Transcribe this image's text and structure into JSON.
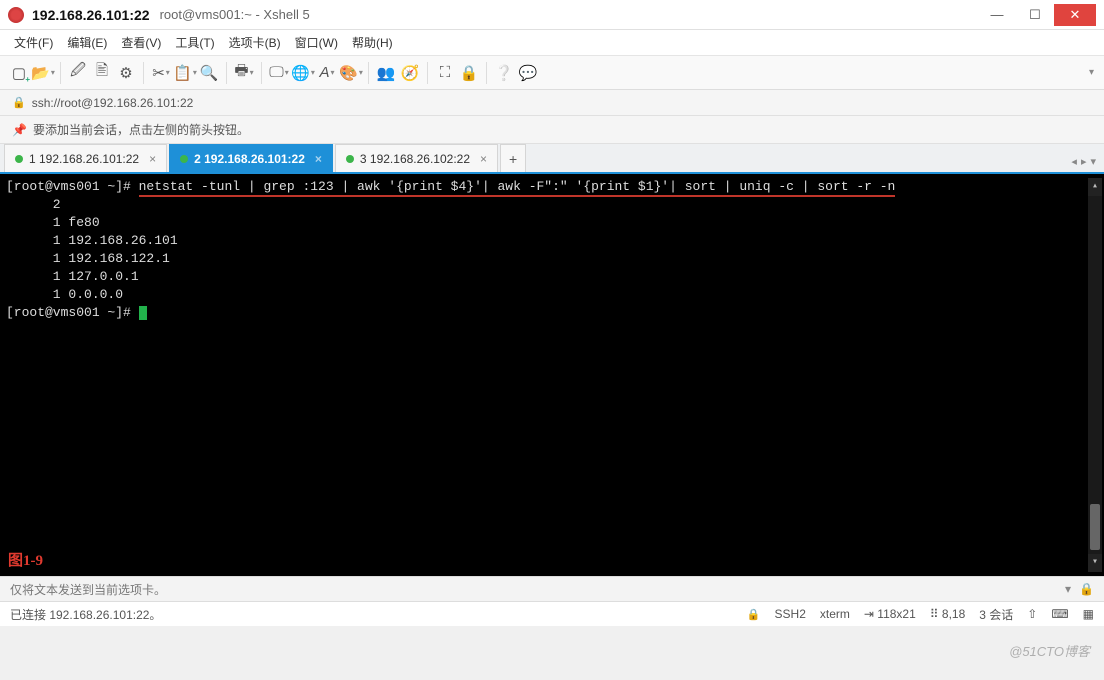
{
  "window": {
    "title_main": "192.168.26.101:22",
    "title_sub": "root@vms001:~ - Xshell 5"
  },
  "menu": {
    "file": "文件(F)",
    "edit": "编辑(E)",
    "view": "查看(V)",
    "tools": "工具(T)",
    "tabs": "选项卡(B)",
    "window": "窗口(W)",
    "help": "帮助(H)"
  },
  "address": {
    "url": "ssh://root@192.168.26.101:22"
  },
  "hint": {
    "text": "要添加当前会话，点击左侧的箭头按钮。"
  },
  "tabs": {
    "t1": "1 192.168.26.101:22",
    "t2": "2 192.168.26.101:22",
    "t3": "3 192.168.26.102:22"
  },
  "terminal": {
    "prompt": "[root@vms001 ~]# ",
    "cmd": "netstat -tunl | grep :123 | awk '{print $4}'| awk -F\":\" '{print $1}'| sort | uniq -c | sort -r -n",
    "lines": [
      "      2 ",
      "      1 fe80",
      "      1 192.168.26.101",
      "      1 192.168.122.1",
      "      1 127.0.0.1",
      "      1 0.0.0.0"
    ],
    "figlabel": "图1-9"
  },
  "sendbar": {
    "placeholder": "仅将文本发送到当前选项卡。"
  },
  "status": {
    "conn": "已连接 192.168.26.101:22。",
    "proto": "SSH2",
    "term": "xterm",
    "size": "118x21",
    "pos": "8,18",
    "sessions": "3 会话"
  },
  "watermark": "@51CTO博客"
}
